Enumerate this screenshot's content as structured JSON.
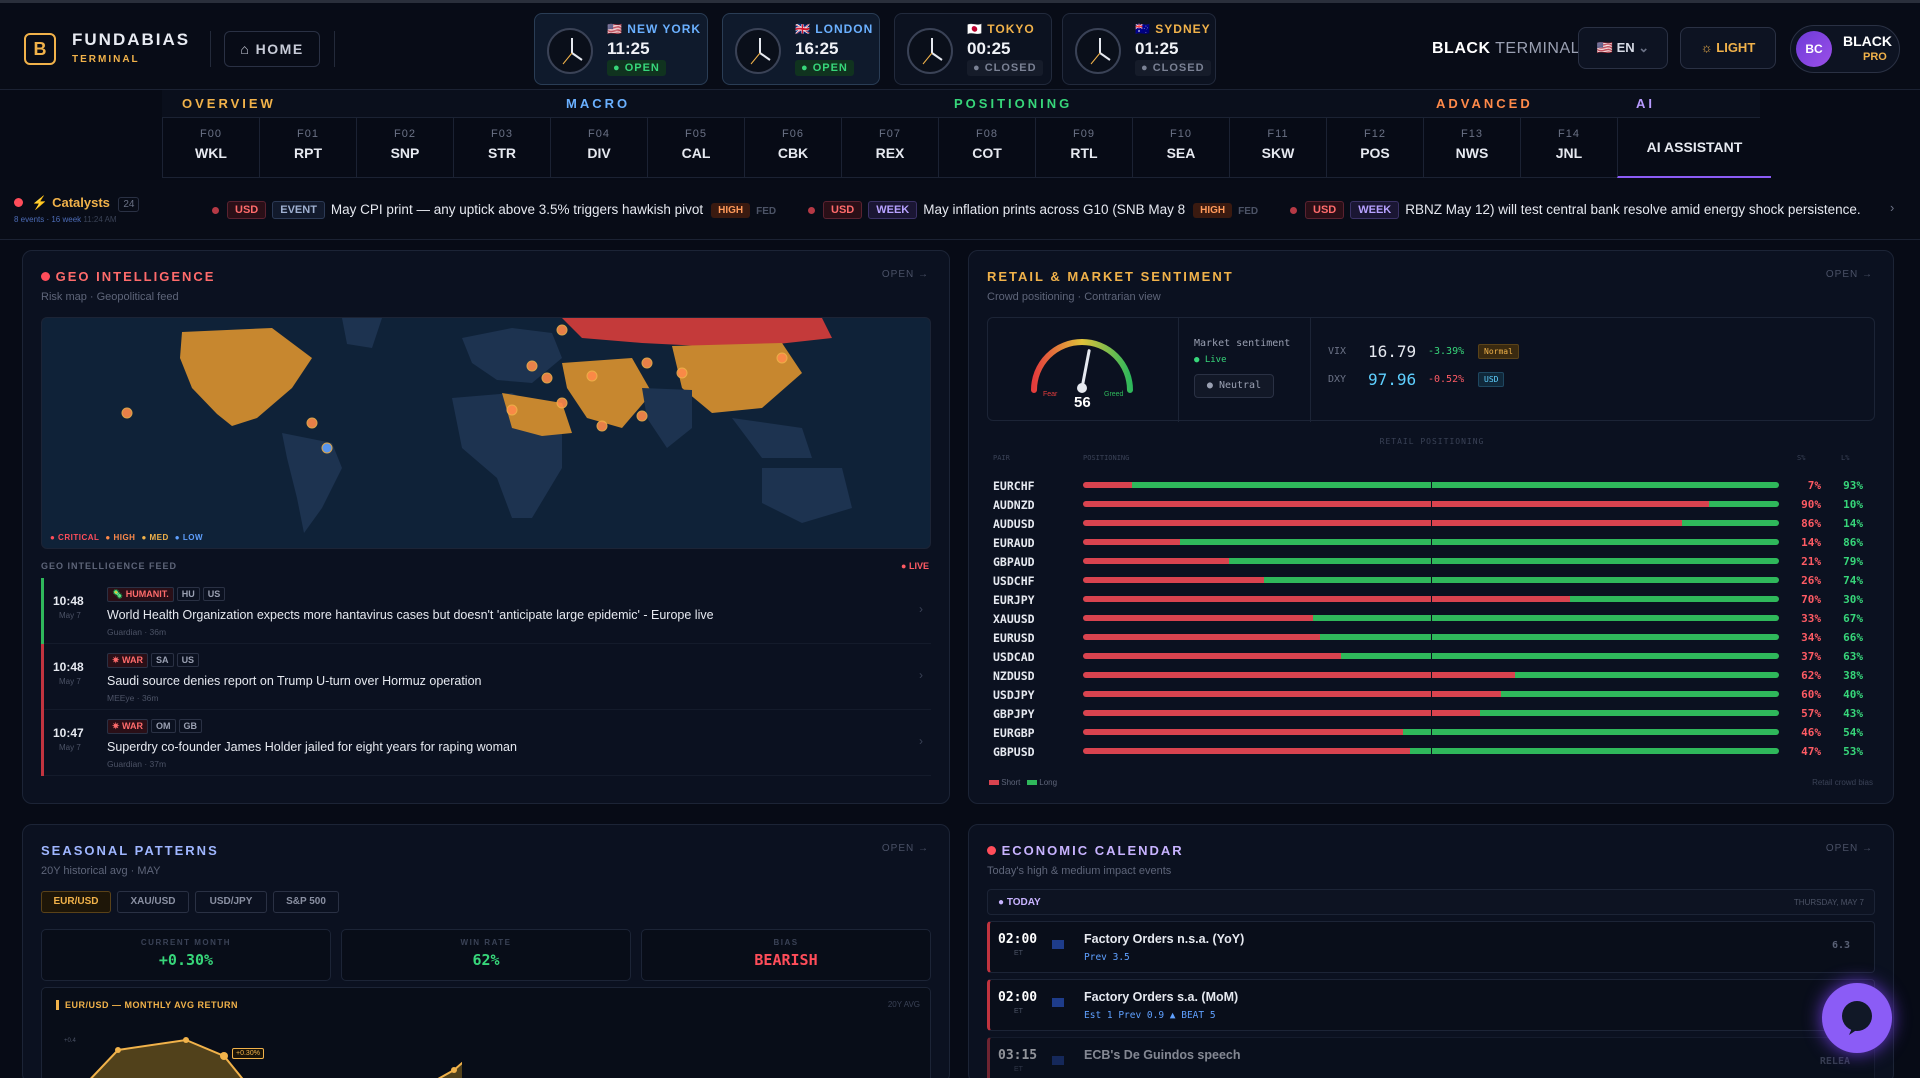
{
  "brand": {
    "name": "FUNDABIAS",
    "sub": "TERMINAL",
    "logo": "B"
  },
  "home": "⌂ HOME",
  "clocks": [
    {
      "flag": "🇺🇸",
      "city": "NEW YORK",
      "time": "11:25",
      "status": "● OPEN",
      "open": true
    },
    {
      "flag": "🇬🇧",
      "city": "LONDON",
      "time": "16:25",
      "status": "● OPEN",
      "open": true
    },
    {
      "flag": "🇯🇵",
      "city": "TOKYO",
      "time": "00:25",
      "status": "● CLOSED",
      "open": false
    },
    {
      "flag": "🇦🇺",
      "city": "SYDNEY",
      "time": "01:25",
      "status": "● CLOSED",
      "open": false
    }
  ],
  "header": {
    "title_bold": "BLACK",
    "title_rest": "TERMINAL",
    "lang": "EN",
    "theme": "LIGHT",
    "user_initials": "BC",
    "user_name": "BLACK",
    "user_tier": "PRO"
  },
  "nav": {
    "groups": [
      "OVERVIEW",
      "MACRO",
      "POSITIONING",
      "ADVANCED",
      "AI"
    ],
    "tabs": [
      {
        "k": "F00",
        "l": "WKL"
      },
      {
        "k": "F01",
        "l": "RPT"
      },
      {
        "k": "F02",
        "l": "SNP"
      },
      {
        "k": "F03",
        "l": "STR"
      },
      {
        "k": "F04",
        "l": "DIV"
      },
      {
        "k": "F05",
        "l": "CAL"
      },
      {
        "k": "F06",
        "l": "CBK"
      },
      {
        "k": "F07",
        "l": "REX"
      },
      {
        "k": "F08",
        "l": "COT"
      },
      {
        "k": "F09",
        "l": "RTL"
      },
      {
        "k": "F10",
        "l": "SEA"
      },
      {
        "k": "F11",
        "l": "SKW"
      },
      {
        "k": "F12",
        "l": "POS"
      },
      {
        "k": "F13",
        "l": "NWS"
      },
      {
        "k": "F14",
        "l": "JNL"
      },
      {
        "k": "",
        "l": "AI ASSISTANT"
      }
    ]
  },
  "catalysts": {
    "title": "Catalysts",
    "count": "24",
    "events": "8 events",
    "week": "16 week",
    "time": "11:24 AM",
    "items": [
      {
        "ccy": "USD",
        "type": "EVENT",
        "text": "May CPI print — any uptick above 3.5% triggers hawkish pivot",
        "impact": "HIGH",
        "src": "FED"
      },
      {
        "ccy": "USD",
        "type": "WEEK",
        "text": "May inflation prints across G10 (SNB May 8",
        "impact": "HIGH",
        "src": "FED"
      },
      {
        "ccy": "USD",
        "type": "WEEK",
        "text": "RBNZ May 12) will test central bank resolve amid energy shock persistence.",
        "impact": "",
        "src": ""
      }
    ]
  },
  "geo": {
    "title": "GEO INTELLIGENCE",
    "sub": "Risk map · Geopolitical feed",
    "open": "OPEN →",
    "legend": [
      "● CRITICAL",
      "● HIGH",
      "● MED",
      "● LOW"
    ],
    "feed_title": "GEO INTELLIGENCE FEED",
    "live": "● LIVE",
    "feed": [
      {
        "time": "10:48",
        "date": "May 7",
        "tags": [
          "🦠 HUMANIT.",
          "HU",
          "US"
        ],
        "headline": "World Health Organization expects more hantavirus cases but doesn't 'anticipate large epidemic' - Europe live",
        "src": "Guardian · 36m"
      },
      {
        "time": "10:48",
        "date": "May 7",
        "tags": [
          "✷ WAR",
          "SA",
          "US"
        ],
        "headline": "Saudi source denies report on Trump U-turn over Hormuz operation",
        "src": "MEEye · 36m"
      },
      {
        "time": "10:47",
        "date": "May 7",
        "tags": [
          "✷ WAR",
          "OM",
          "GB"
        ],
        "headline": "Superdry co-founder James Holder jailed for eight years for raping woman",
        "src": "Guardian · 37m"
      }
    ]
  },
  "sentiment": {
    "title": "RETAIL & MARKET SENTIMENT",
    "sub": "Crowd positioning · Contrarian view",
    "open": "OPEN →",
    "gauge_value": "56",
    "fear": "Fear",
    "greed": "Greed",
    "gauge_fraction": 0.56,
    "market_label": "Market sentiment",
    "live": "● Live",
    "state": "● Neutral",
    "vix": {
      "label": "VIX",
      "value": "16.79",
      "chg": "-3.39%",
      "badge": "Normal"
    },
    "dxy": {
      "label": "DXY",
      "value": "97.96",
      "chg": "-0.52%",
      "badge": "USD"
    },
    "section": "RETAIL POSITIONING",
    "col_pair": "PAIR",
    "col_pos": "POSITIONING",
    "col_s": "S%",
    "col_l": "L%",
    "rows": [
      {
        "p": "EURCHF",
        "s": 7,
        "l": 93
      },
      {
        "p": "AUDNZD",
        "s": 90,
        "l": 10
      },
      {
        "p": "AUDUSD",
        "s": 86,
        "l": 14
      },
      {
        "p": "EURAUD",
        "s": 14,
        "l": 86
      },
      {
        "p": "GBPAUD",
        "s": 21,
        "l": 79
      },
      {
        "p": "USDCHF",
        "s": 26,
        "l": 74
      },
      {
        "p": "EURJPY",
        "s": 70,
        "l": 30
      },
      {
        "p": "XAUUSD",
        "s": 33,
        "l": 67
      },
      {
        "p": "EURUSD",
        "s": 34,
        "l": 66
      },
      {
        "p": "USDCAD",
        "s": 37,
        "l": 63
      },
      {
        "p": "NZDUSD",
        "s": 62,
        "l": 38
      },
      {
        "p": "USDJPY",
        "s": 60,
        "l": 40
      },
      {
        "p": "GBPJPY",
        "s": 57,
        "l": 43
      },
      {
        "p": "EURGBP",
        "s": 46,
        "l": 54
      },
      {
        "p": "GBPUSD",
        "s": 47,
        "l": 53
      }
    ],
    "legend_short": "Short",
    "legend_long": "Long",
    "footer": "Retail crowd bias"
  },
  "seasonal": {
    "title": "SEASONAL PATTERNS",
    "sub": "20Y historical avg · MAY",
    "open": "OPEN →",
    "tabs": [
      "EUR/USD",
      "XAU/USD",
      "USD/JPY",
      "S&P 500"
    ],
    "stats": [
      {
        "k": "CURRENT MONTH",
        "v": "+0.30%"
      },
      {
        "k": "WIN RATE",
        "v": "62%"
      },
      {
        "k": "BIAS",
        "v": "BEARISH"
      }
    ],
    "chart_title": "EUR/USD — MONTHLY AVG RETURN",
    "chart_tag": "20Y AVG",
    "ytick": "+0.4",
    "callout": "+0.30%"
  },
  "calendar": {
    "title": "ECONOMIC CALENDAR",
    "sub": "Today's high & medium impact events",
    "open": "OPEN →",
    "today": "● TODAY",
    "date": "THURSDAY, MAY 7",
    "events": [
      {
        "time": "02:00",
        "tz": "ET",
        "title": "Factory Orders n.s.a. (YoY)",
        "sub": "Prev 3.5",
        "val": "6.3"
      },
      {
        "time": "02:00",
        "tz": "ET",
        "title": "Factory Orders s.a. (MoM)",
        "sub": "Est 1  Prev 0.9  ▲ BEAT 5",
        "val": ""
      },
      {
        "time": "03:15",
        "tz": "ET",
        "title": "ECB's De Guindos speech",
        "sub": "",
        "val": "RELEA"
      }
    ]
  }
}
